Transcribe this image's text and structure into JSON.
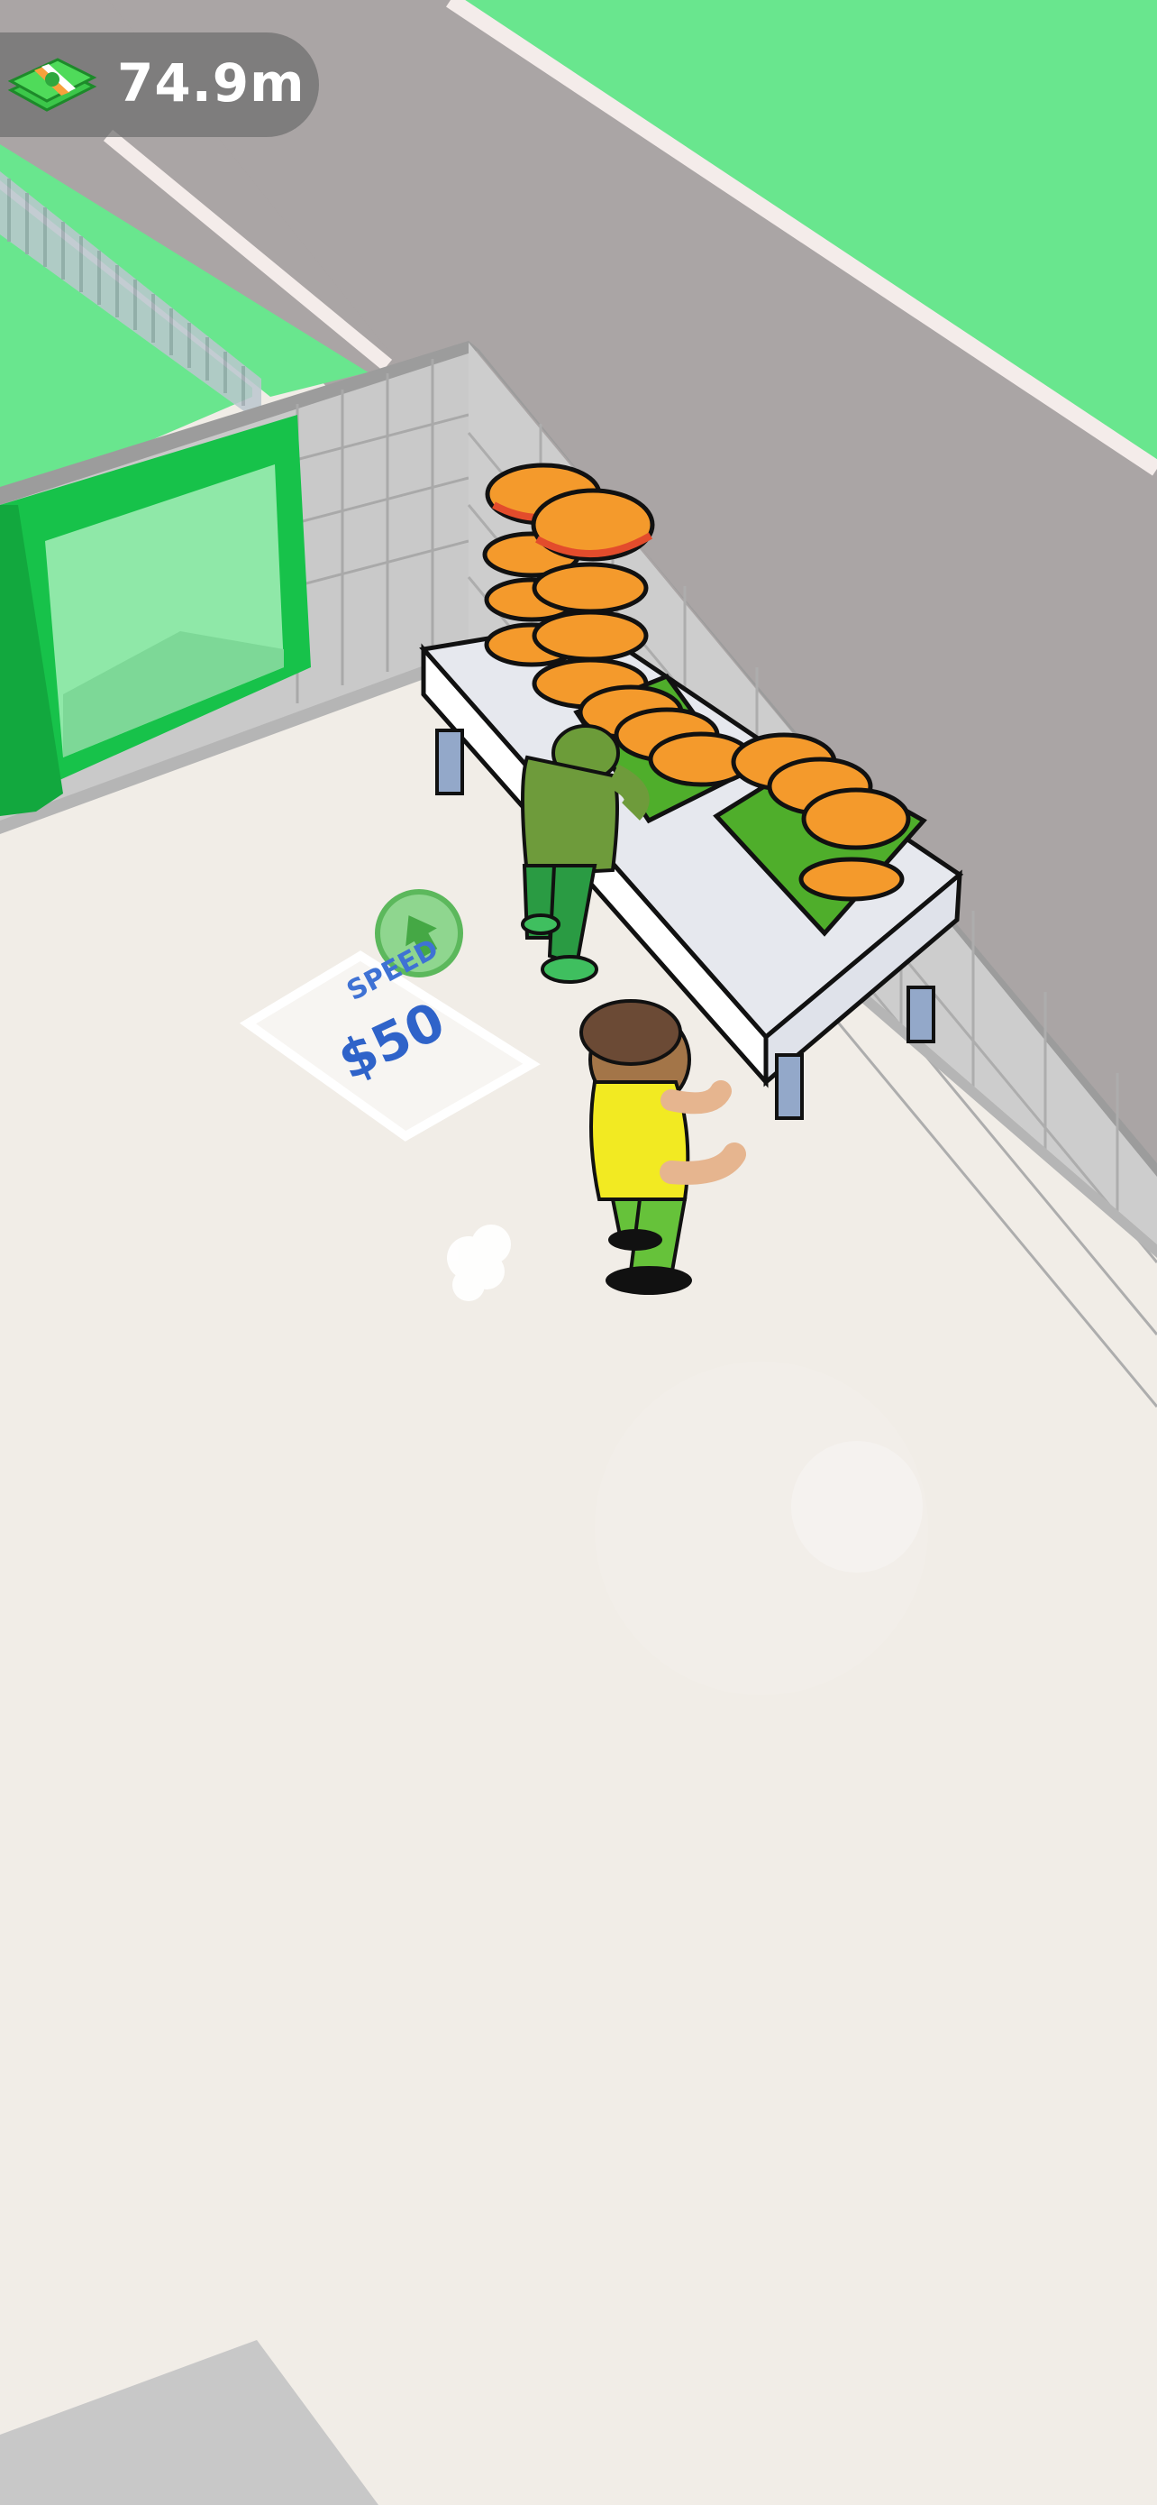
{
  "hud": {
    "money": "74.9m",
    "money_icon": "cash-stack-icon"
  },
  "upgrade_pad": {
    "label": "SPEED",
    "price": "$50",
    "arrow_icon": "upgrade-arrow-icon"
  },
  "colors": {
    "grass": "#69e68e",
    "road": "#aaa5a5",
    "floor": "#f1ede7",
    "door_frame": "#19c44b",
    "pad_text": "#2f63c9",
    "hud_bg": "#6e6e6e"
  }
}
